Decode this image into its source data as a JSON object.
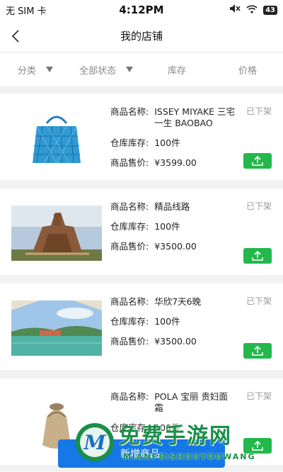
{
  "status_bar": {
    "carrier": "无 SIM 卡",
    "time": "4:12PM",
    "battery": "43"
  },
  "nav": {
    "title": "我的店铺"
  },
  "filters": [
    {
      "label": "分类",
      "has_dropdown": true
    },
    {
      "label": "全部状态",
      "has_dropdown": true
    },
    {
      "label": "库存",
      "has_dropdown": false
    },
    {
      "label": "价格",
      "has_dropdown": false
    }
  ],
  "labels": {
    "name": "商品名称:",
    "stock": "仓库库存:",
    "price": "商品售价:"
  },
  "products": [
    {
      "name": "ISSEY MIYAKE 三宅一生 BAOBAO",
      "stock": "100件",
      "price": "¥3599.00",
      "status": "已下架",
      "image": "blue-geometric-handbag"
    },
    {
      "name": "精品线路",
      "stock": "100件",
      "price": "¥3500.00",
      "status": "已下架",
      "image": "temple-ruins-photo"
    },
    {
      "name": "华欣7天6晚",
      "stock": "100件",
      "price": "¥3500.00",
      "status": "已下架",
      "image": "resort-lagoon-photo"
    },
    {
      "name": "POLA 宝丽 贵妇面霜",
      "stock": "100件",
      "price": "",
      "status": "已下架",
      "image": "gold-cream-jar"
    }
  ],
  "add_button": "新增商品",
  "watermark": {
    "cn": "免费手游网",
    "en": "MIANFEISHOUYOUWANG"
  },
  "colors": {
    "upload_green": "#22b84b",
    "add_blue": "#1677e6",
    "watermark_green": "#1a8f4a"
  }
}
